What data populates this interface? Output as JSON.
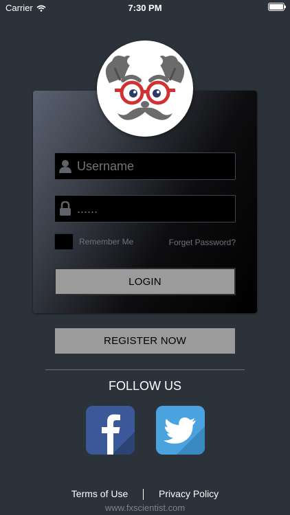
{
  "status_bar": {
    "carrier": "Carrier",
    "time": "7:30 PM"
  },
  "login_form": {
    "username_placeholder": "Username",
    "password_placeholder": "......",
    "remember_label": "Remember Me",
    "forgot_label": "Forget Password?",
    "login_label": "LOGIN"
  },
  "register_label": "REGISTER NOW",
  "follow_label": "FOLLOW US",
  "social": [
    {
      "name": "facebook",
      "icon": "facebook-icon",
      "color": "#3b5998"
    },
    {
      "name": "twitter",
      "icon": "twitter-icon",
      "color": "#4aa3df"
    }
  ],
  "footer": {
    "terms_label": "Terms of Use",
    "privacy_label": "Privacy Policy",
    "website": "www.fxscientist.com"
  },
  "colors": {
    "background": "#2b323a",
    "button": "#9b9b9b",
    "avatar_glasses": "#d03232"
  }
}
